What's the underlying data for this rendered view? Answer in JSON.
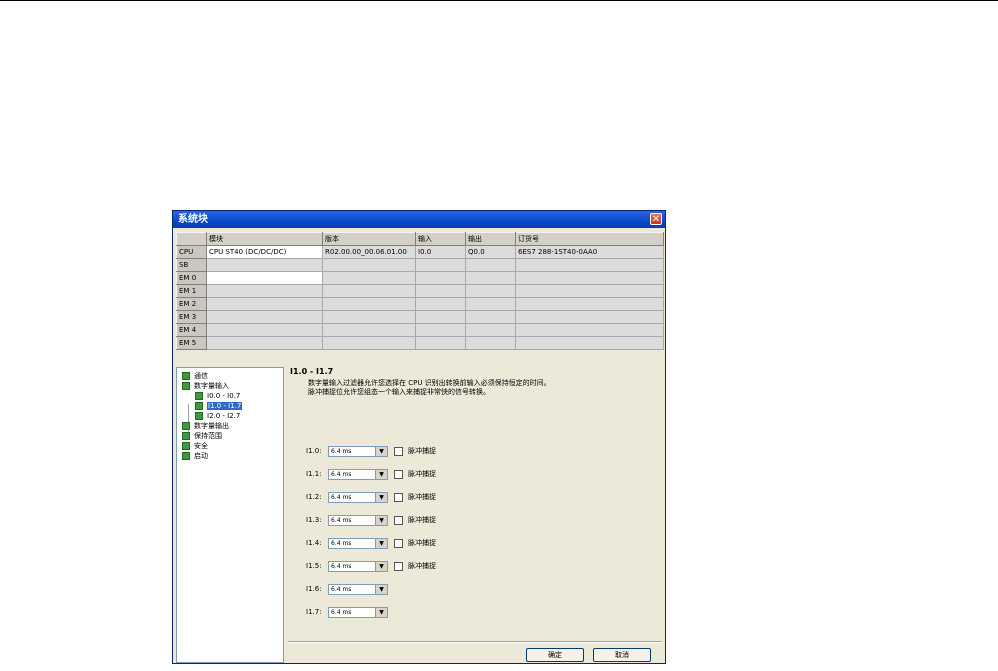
{
  "window": {
    "title": "系统块"
  },
  "table": {
    "headers": [
      "",
      "模块",
      "版本",
      "输入",
      "输出",
      "订货号"
    ],
    "rows": [
      {
        "slot": "CPU",
        "module": "CPU ST40 (DC/DC/DC)",
        "version": "R02.00.00_00.06.01.00",
        "input": "I0.0",
        "output": "Q0.0",
        "order": "6ES7 288-1ST40-0AA0"
      },
      {
        "slot": "SB",
        "module": "",
        "version": "",
        "input": "",
        "output": "",
        "order": ""
      },
      {
        "slot": "EM 0",
        "module": "",
        "version": "",
        "input": "",
        "output": "",
        "order": ""
      },
      {
        "slot": "EM 1",
        "module": "",
        "version": "",
        "input": "",
        "output": "",
        "order": ""
      },
      {
        "slot": "EM 2",
        "module": "",
        "version": "",
        "input": "",
        "output": "",
        "order": ""
      },
      {
        "slot": "EM 3",
        "module": "",
        "version": "",
        "input": "",
        "output": "",
        "order": ""
      },
      {
        "slot": "EM 4",
        "module": "",
        "version": "",
        "input": "",
        "output": "",
        "order": ""
      },
      {
        "slot": "EM 5",
        "module": "",
        "version": "",
        "input": "",
        "output": "",
        "order": ""
      }
    ]
  },
  "tree": [
    {
      "label": "通信",
      "level": 0
    },
    {
      "label": "数字量输入",
      "level": 0
    },
    {
      "label": "I0.0 - I0.7",
      "level": 1
    },
    {
      "label": "I1.0 - I1.7",
      "level": 1,
      "selected": true
    },
    {
      "label": "I2.0 - I2.7",
      "level": 1
    },
    {
      "label": "数字量输出",
      "level": 0
    },
    {
      "label": "保持范围",
      "level": 0
    },
    {
      "label": "安全",
      "level": 0
    },
    {
      "label": "启动",
      "level": 0
    }
  ],
  "panel": {
    "title": "I1.0 - I1.7",
    "desc1": "数字量输入过滤器允许您选择在 CPU 识别出转换前输入必须保持恒定的时间。",
    "desc2": "脉冲捕捉位允许您组态一个输入来捕捉非常快的信号转换。",
    "inputs": [
      {
        "label": "I1.0:",
        "value": "6.4 ms",
        "capture": "脉冲捕捉"
      },
      {
        "label": "I1.1:",
        "value": "6.4 ms",
        "capture": "脉冲捕捉"
      },
      {
        "label": "I1.2:",
        "value": "6.4 ms",
        "capture": "脉冲捕捉"
      },
      {
        "label": "I1.3:",
        "value": "6.4 ms",
        "capture": "脉冲捕捉"
      },
      {
        "label": "I1.4:",
        "value": "6.4 ms",
        "capture": "脉冲捕捉"
      },
      {
        "label": "I1.5:",
        "value": "6.4 ms",
        "capture": "脉冲捕捉"
      },
      {
        "label": "I1.6:",
        "value": "6.4 ms"
      },
      {
        "label": "I1.7:",
        "value": "6.4 ms"
      }
    ],
    "ok": "确定",
    "cancel": "取消"
  }
}
